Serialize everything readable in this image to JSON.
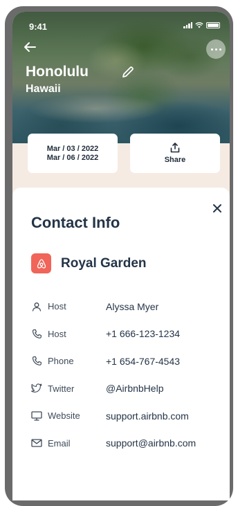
{
  "status": {
    "time": "9:41"
  },
  "hero": {
    "city": "Honolulu",
    "region": "Hawaii",
    "date_from": "Mar / 03 / 2022",
    "date_to": "Mar / 06 / 2022",
    "share_label": "Share"
  },
  "sheet": {
    "title": "Contact Info",
    "place_name": "Royal Garden",
    "brand_color": "#f06459",
    "rows": [
      {
        "icon": "person-icon",
        "label": "Host",
        "value": "Alyssa Myer"
      },
      {
        "icon": "phone-icon",
        "label": "Host",
        "value": "+1 666-123-1234"
      },
      {
        "icon": "phone-icon",
        "label": "Phone",
        "value": "+1 654-767-4543"
      },
      {
        "icon": "twitter-icon",
        "label": "Twitter",
        "value": "@AirbnbHelp"
      },
      {
        "icon": "monitor-icon",
        "label": "Website",
        "value": "support.airbnb.com"
      },
      {
        "icon": "mail-icon",
        "label": "Email",
        "value": "support@airbnb.com"
      }
    ]
  }
}
